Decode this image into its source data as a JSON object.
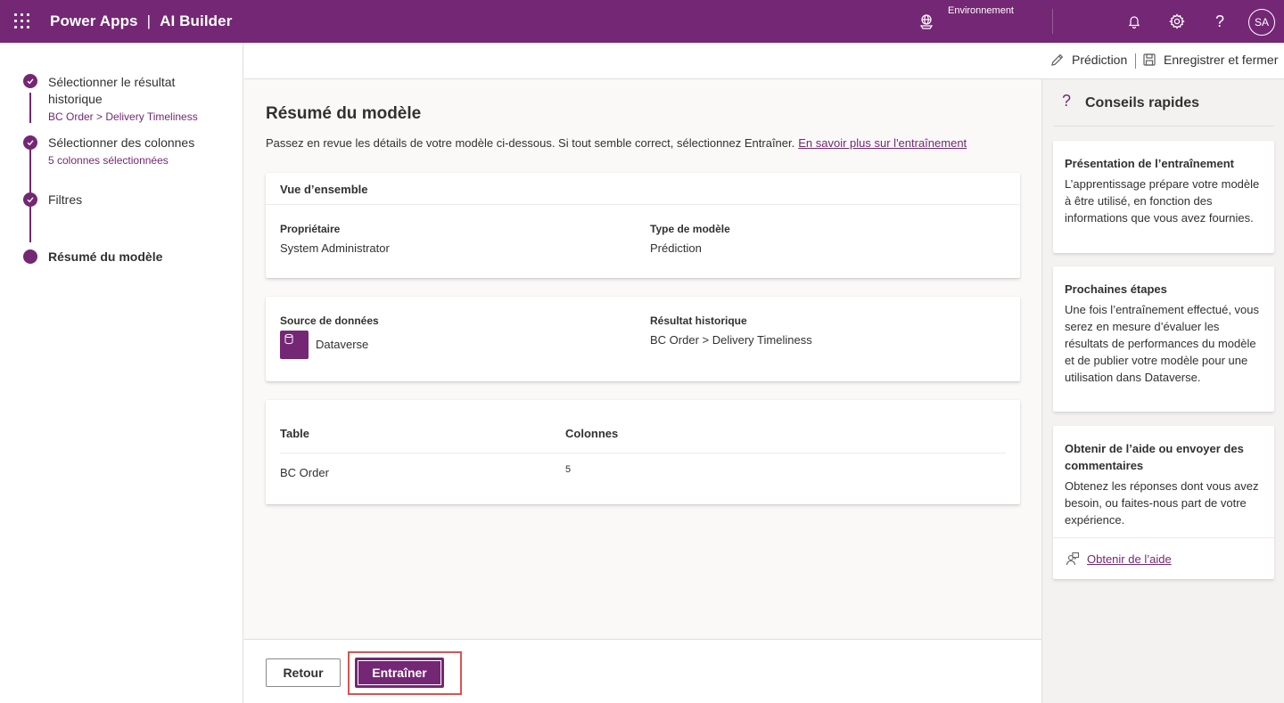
{
  "header": {
    "app_name": "Power Apps",
    "separator": "|",
    "product": "AI Builder",
    "environment_label": "Environnement",
    "avatar_initials": "SA",
    "icons": [
      "waffle-icon",
      "environment-icon",
      "bell-icon",
      "gear-icon",
      "help-icon"
    ]
  },
  "stepper": {
    "steps": [
      {
        "title": "Sélectionner le résultat historique",
        "subtitle": "BC Order > Delivery Timeliness",
        "state": "completed"
      },
      {
        "title": "Sélectionner des colonnes",
        "subtitle": "5 colonnes sélectionnées",
        "state": "completed"
      },
      {
        "title": "Filtres",
        "subtitle": "",
        "state": "completed"
      },
      {
        "title": "Résumé du modèle",
        "subtitle": "",
        "state": "current"
      }
    ]
  },
  "commandbar": {
    "prediction_label": "Prédiction",
    "separator": "|",
    "save_close_label": "Enregistrer et fermer"
  },
  "main": {
    "title": "Résumé du modèle",
    "description": "Passez en revue les détails de votre modèle ci-dessous. Si tout semble correct, sélectionnez Entraîner.",
    "learn_more_link": "En savoir plus sur l'entraînement",
    "overview": {
      "heading": "Vue d’ensemble",
      "owner_label": "Propriétaire",
      "owner_value": "System Administrator",
      "model_type_label": "Type de modèle",
      "model_type_value": "Prédiction"
    },
    "source": {
      "data_source_label": "Source de données",
      "data_source_value": "Dataverse",
      "historical_label": "Résultat historique",
      "historical_value": "BC Order > Delivery Timeliness"
    },
    "table": {
      "columns": [
        "Table",
        "Colonnes"
      ],
      "rows": [
        {
          "table": "BC Order",
          "columns": "5"
        }
      ]
    }
  },
  "footer": {
    "back_label": "Retour",
    "train_label": "Entraîner"
  },
  "quick_tips": {
    "title": "Conseils rapides",
    "cards": [
      {
        "title": "Présentation de l’entraînement",
        "text": "L’apprentissage prépare votre modèle à être utilisé, en fonction des informations que vous avez fournies."
      },
      {
        "title": "Prochaines étapes",
        "text": "Une fois l’entraînement effectué, vous serez en mesure d’évaluer les résultats de performances du modèle et de publier votre modèle pour une utilisation dans Dataverse."
      },
      {
        "title": "Obtenir de l’aide ou envoyer des commentaires",
        "text": "Obtenez les réponses dont vous avez besoin, ou faites-nous part de votre expérience.",
        "link": "Obtenir de l’aide"
      }
    ]
  },
  "colors": {
    "brand": "#742774",
    "highlight_border": "#d9534f"
  }
}
